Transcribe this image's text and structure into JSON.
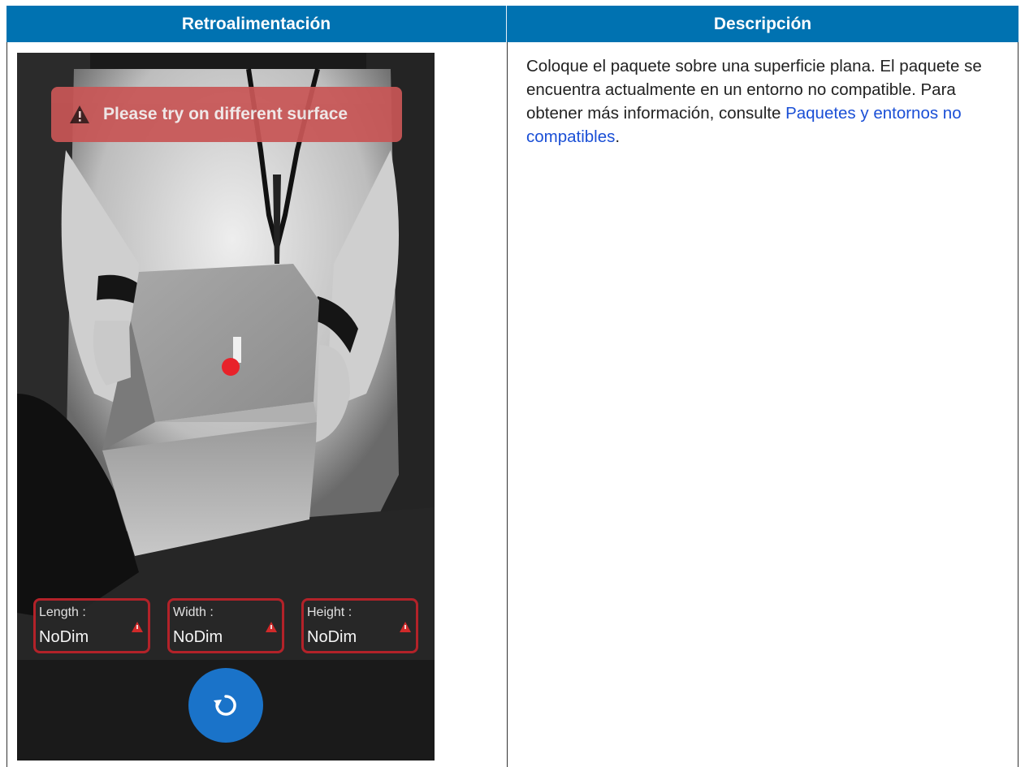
{
  "table": {
    "headers": [
      "Retroalimentación",
      "Descripción"
    ]
  },
  "phone": {
    "banner_message": "Please try on different surface",
    "dimensions": [
      {
        "label": "Length :",
        "value": "NoDim"
      },
      {
        "label": "Width :",
        "value": "NoDim"
      },
      {
        "label": "Height :",
        "value": "NoDim"
      }
    ],
    "icons": [
      "warning-icon",
      "refresh-icon"
    ],
    "colors": {
      "banner": "#c85656",
      "alert_border": "#b32229",
      "button": "#1a73c9",
      "target_dot": "#e8222a"
    }
  },
  "description": {
    "text_before_link": "Coloque el paquete sobre una superficie plana. El paquete se encuentra actualmente en un entorno no compatible. Para obtener más información, consulte ",
    "link_text": "Paquetes y entornos no compatibles",
    "text_after_link": "."
  },
  "colors": {
    "header_bg": "#0072b1",
    "link": "#1a4fd6"
  }
}
